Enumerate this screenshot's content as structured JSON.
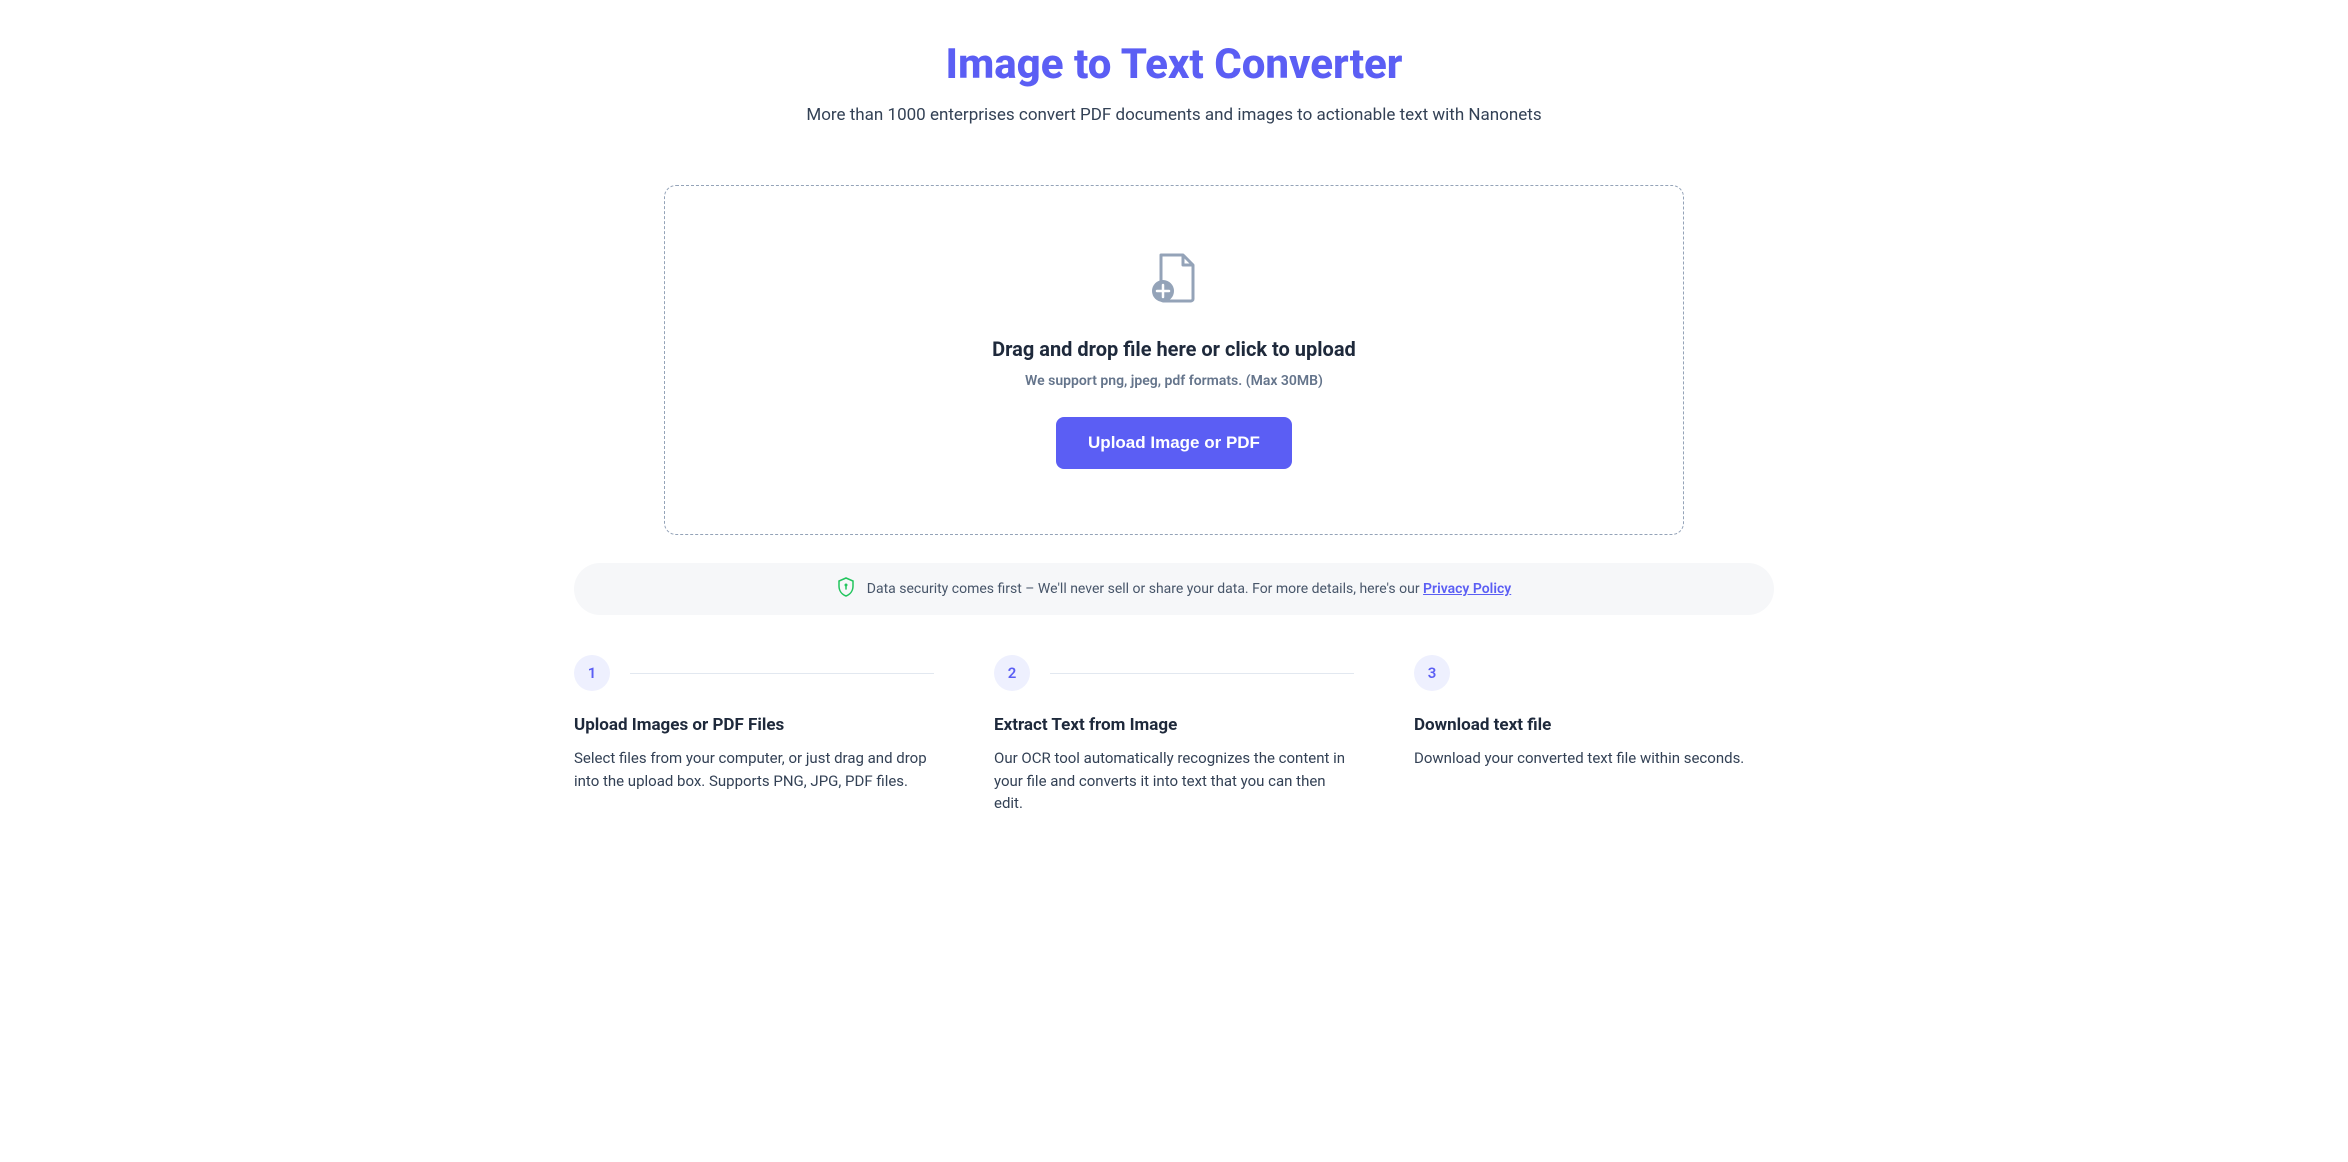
{
  "header": {
    "title": "Image to Text Converter",
    "subtitle": "More than 1000 enterprises convert PDF documents and images to actionable text with Nanonets"
  },
  "upload": {
    "heading": "Drag and drop file here or click to upload",
    "subtext": "We support png, jpeg, pdf formats. (Max 30MB)",
    "button_label": "Upload Image or PDF"
  },
  "security": {
    "text": "Data security comes first – We'll never sell or share your data. For more details, here's our ",
    "link_text": "Privacy Policy"
  },
  "steps": [
    {
      "number": "1",
      "title": "Upload Images or PDF Files",
      "description": "Select files from your computer, or just drag and drop into the upload box. Supports PNG, JPG, PDF files."
    },
    {
      "number": "2",
      "title": "Extract Text from Image",
      "description": "Our OCR tool automatically recognizes the content in your file and converts it into text that you can then edit."
    },
    {
      "number": "3",
      "title": "Download text file",
      "description": "Download your converted text file within seconds."
    }
  ]
}
